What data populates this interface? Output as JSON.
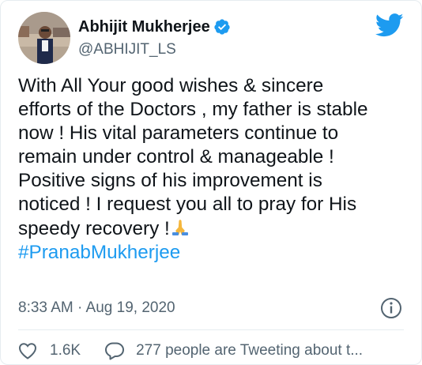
{
  "tweet": {
    "author": {
      "name": "Abhijit Mukherjee",
      "handle": "@ABHIJIT_LS",
      "verified": true
    },
    "text_lines": [
      "With All Your good wishes & sincere",
      "efforts of the Doctors , my father is stable",
      "now ! His vital parameters continue to",
      "remain under control & manageable !",
      "Positive signs of his improvement is",
      "noticed ! I request you all to pray for His",
      "speedy recovery !"
    ],
    "emoji": "folded-hands",
    "hashtag": "#PranabMukherjee",
    "timestamp": "8:33 AM · Aug 19, 2020",
    "likes": "1.6K",
    "conversation": "277 people are Tweeting about t..."
  },
  "icons": {
    "brand": "twitter-bird-icon",
    "verified": "verified-badge-icon",
    "info": "info-icon",
    "like": "heart-icon",
    "reply": "reply-icon"
  },
  "colors": {
    "accent": "#1d9bf0",
    "text": "#0f1419",
    "secondary": "#536471",
    "divider": "#e6ecf0"
  }
}
